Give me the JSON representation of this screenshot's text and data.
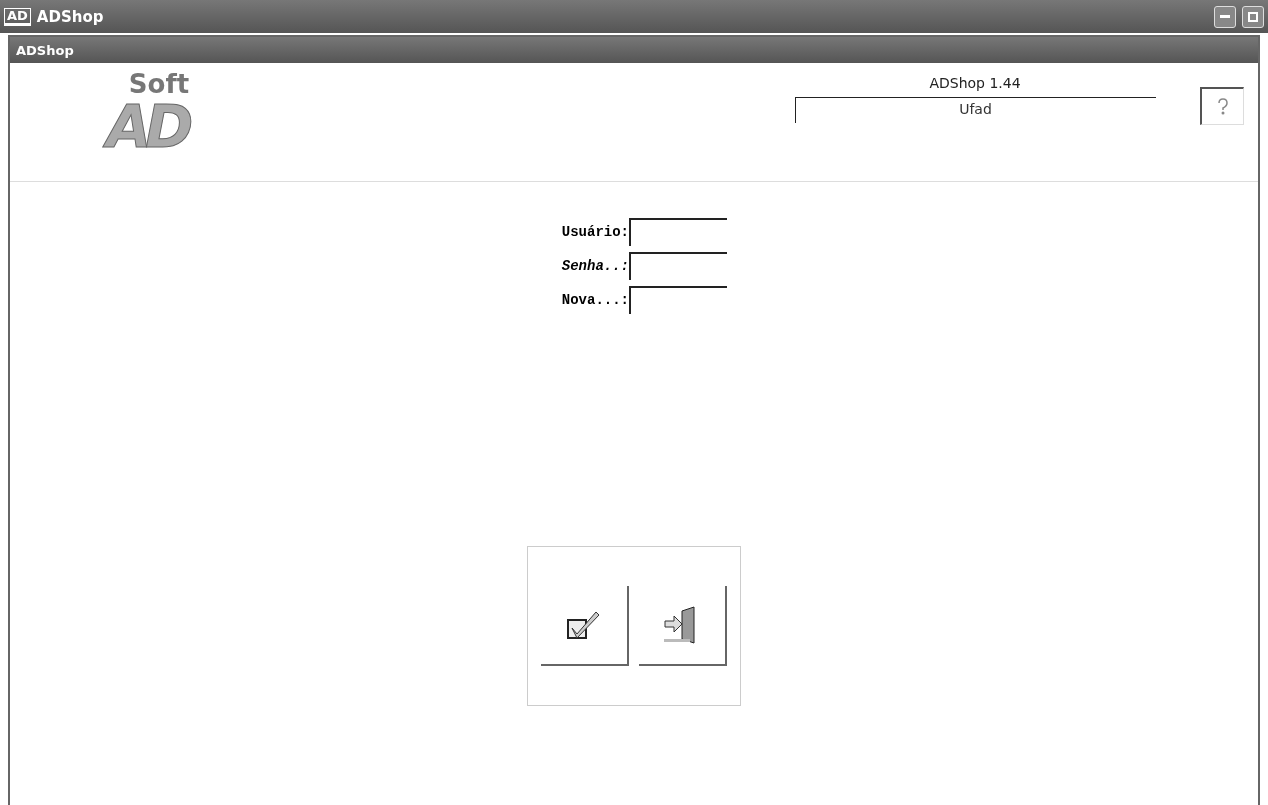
{
  "window": {
    "title": "ADShop",
    "icon_text": "AD"
  },
  "inner_window": {
    "title": "ADShop"
  },
  "logo": {
    "top": "Soft",
    "bottom": "AD"
  },
  "header": {
    "version": "ADShop 1.44",
    "company": "Ufad"
  },
  "form": {
    "fields": [
      {
        "label": "Usuário:",
        "italic": false
      },
      {
        "label": "Senha..:",
        "italic": true
      },
      {
        "label": "Nova...:",
        "italic": false
      }
    ]
  },
  "buttons": [
    {
      "kind": "confirm"
    },
    {
      "kind": "exit"
    }
  ]
}
